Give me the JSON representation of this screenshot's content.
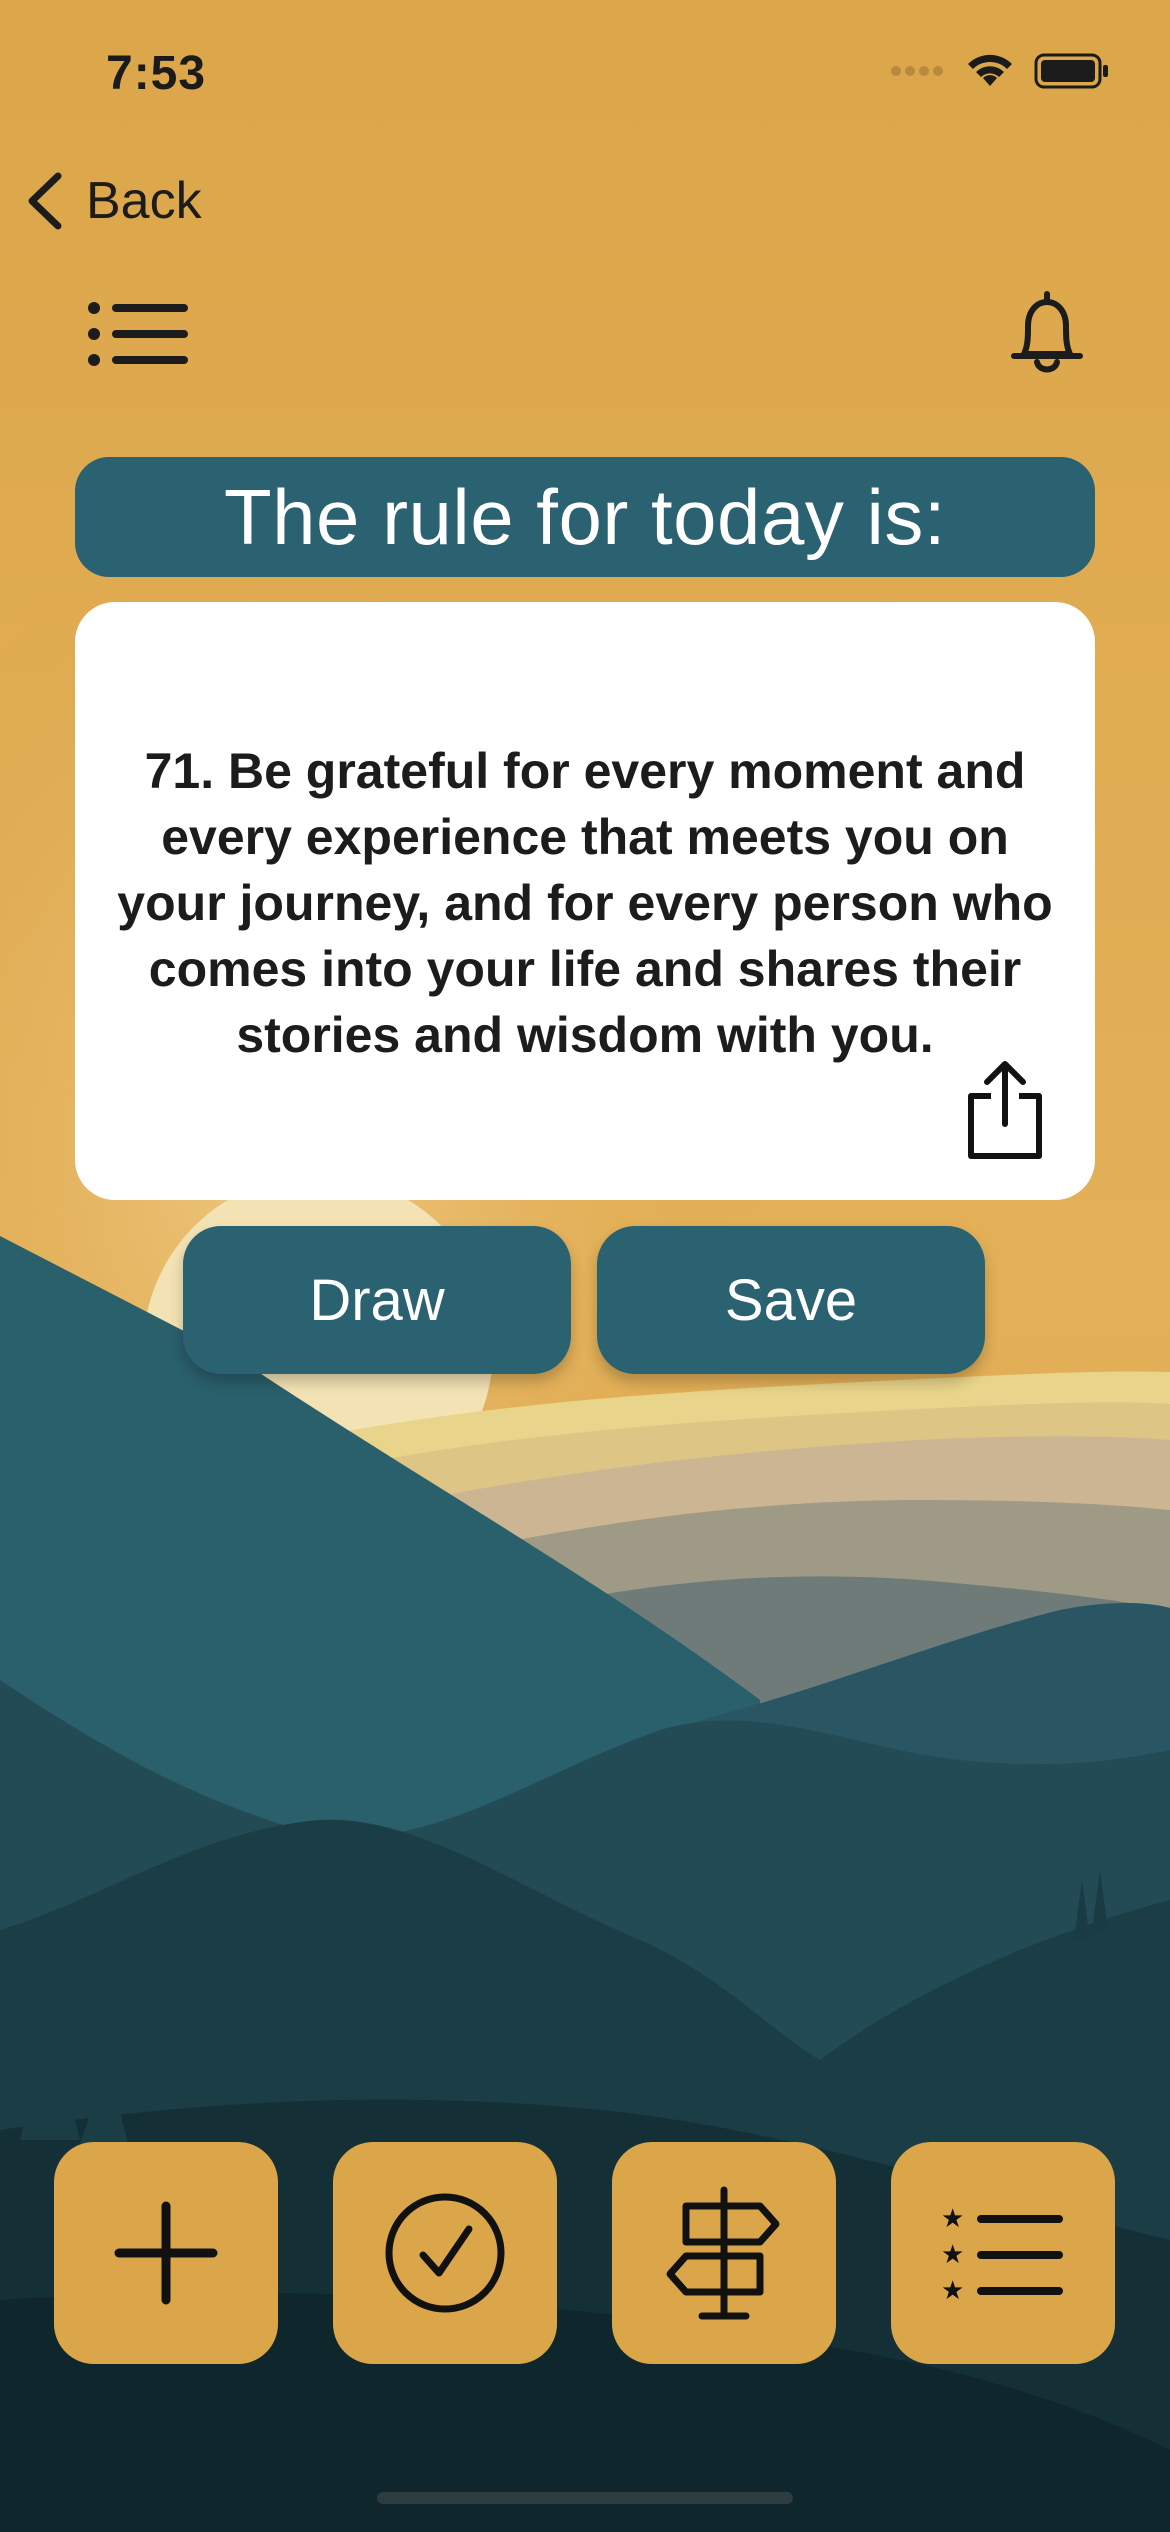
{
  "status_bar": {
    "time": "7:53"
  },
  "nav": {
    "back_label": "Back"
  },
  "header": {
    "title": "The rule for today is:"
  },
  "rule": {
    "text": "71. Be grateful for every moment and every experience that meets you on your journey, and for every person who comes into your life and shares their stories and wisdom with you."
  },
  "actions": {
    "draw_label": "Draw",
    "save_label": "Save"
  },
  "tab_bar": {
    "icons": [
      "plus-icon",
      "checkmark-circle-icon",
      "signpost-icon",
      "starred-list-icon"
    ]
  },
  "colors": {
    "sky": "#dba64a",
    "accent_teal": "#2b6271",
    "card": "#ffffff",
    "tab_button": "#dba64a"
  }
}
